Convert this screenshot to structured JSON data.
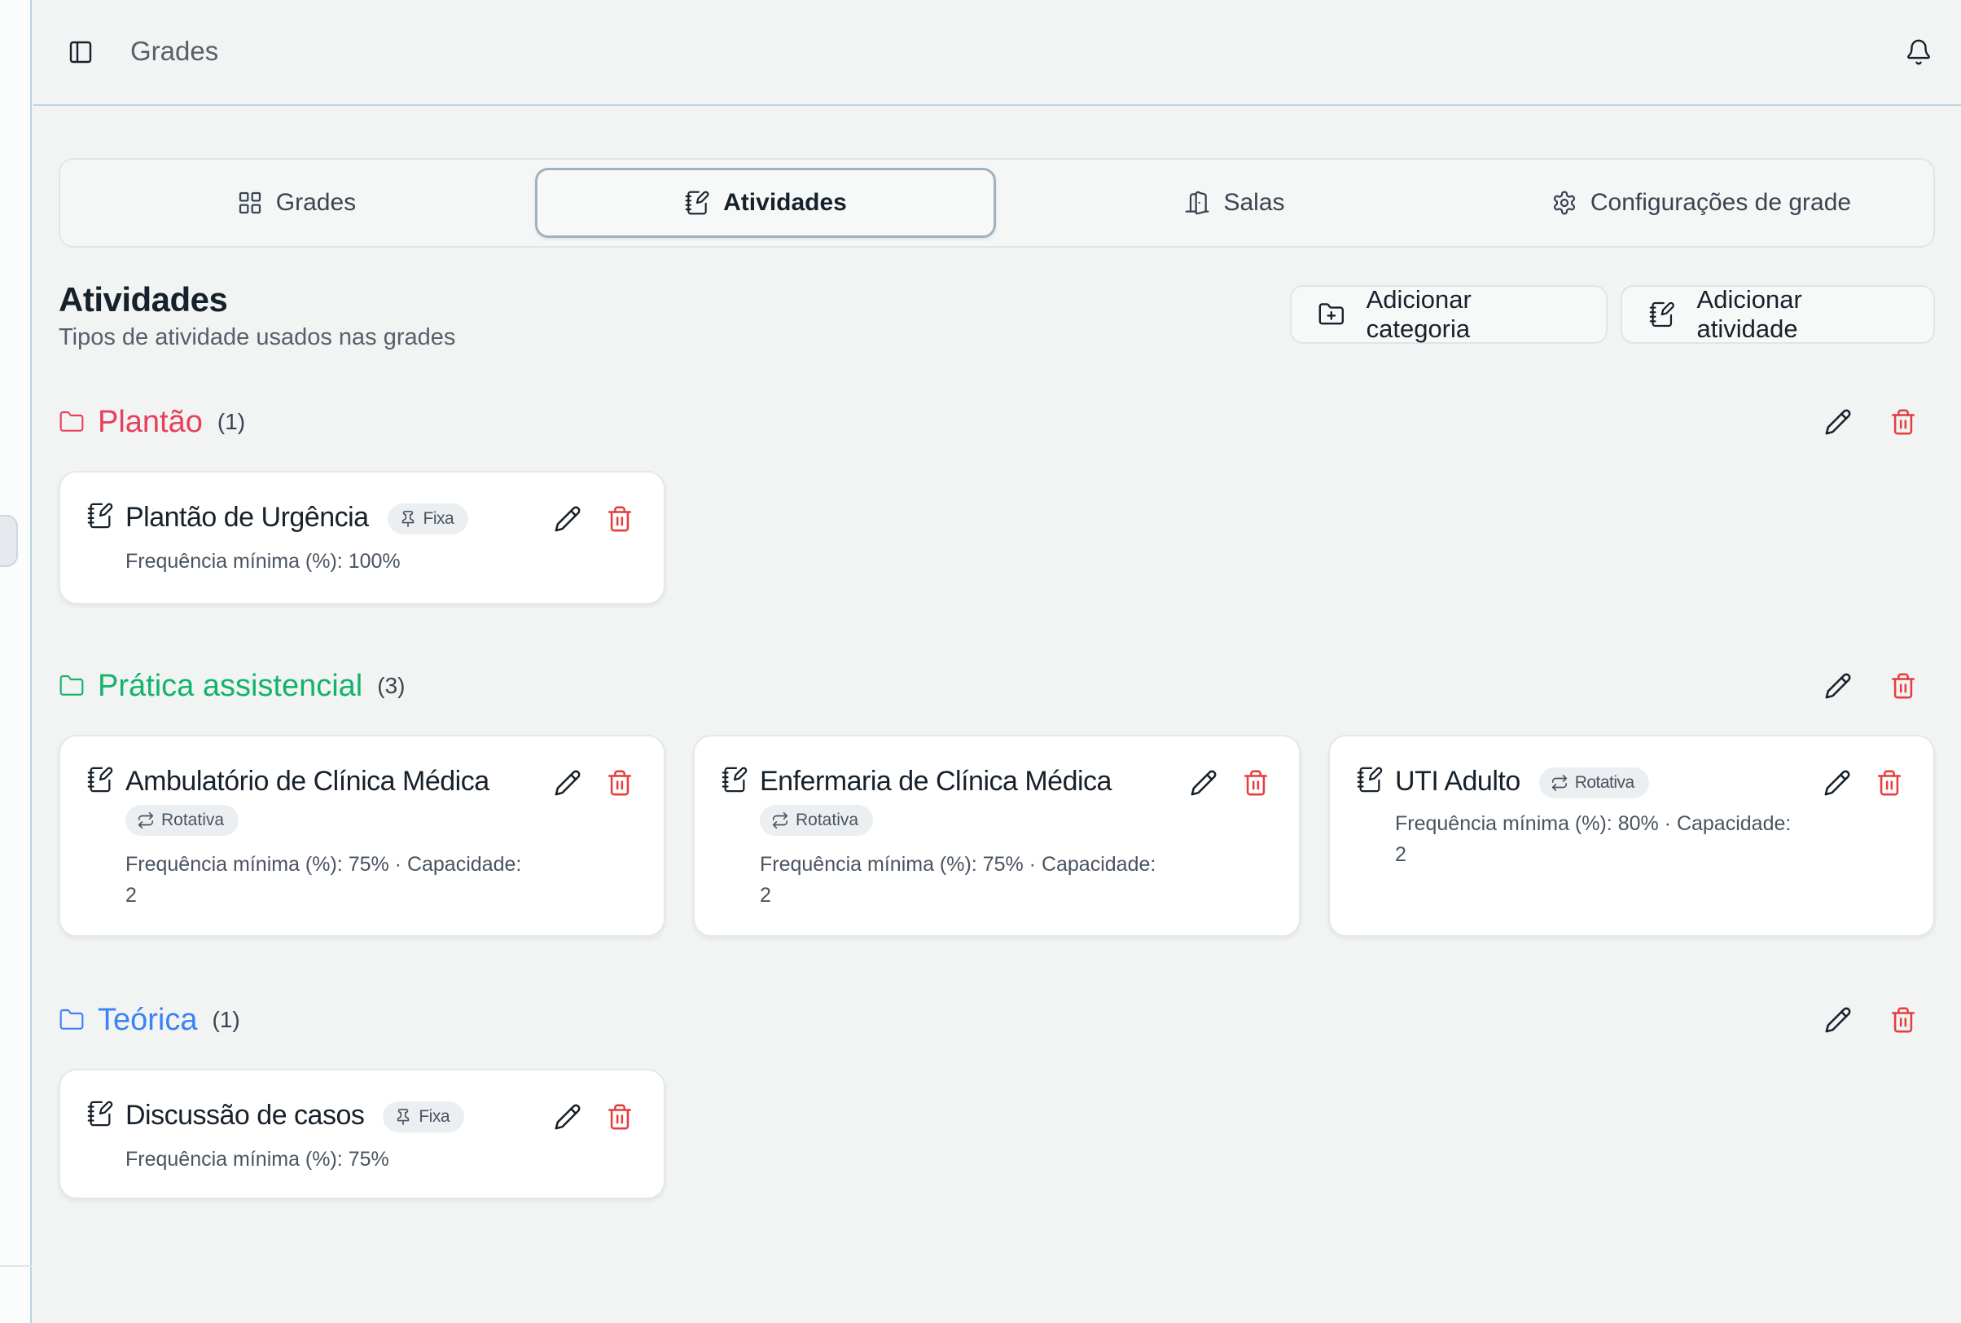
{
  "header": {
    "title": "Grades"
  },
  "tabs": [
    {
      "label": "Grades",
      "icon": "grid-icon"
    },
    {
      "label": "Atividades",
      "icon": "notebook-pen-icon",
      "active": true
    },
    {
      "label": "Salas",
      "icon": "door-icon"
    },
    {
      "label": "Configurações de grade",
      "icon": "gear-icon"
    }
  ],
  "page": {
    "title": "Atividades",
    "subtitle": "Tipos de atividade usados nas grades",
    "add_category": "Adicionar categoria",
    "add_activity": "Adicionar atividade"
  },
  "colors": {
    "plantao": "#e8405c",
    "pratica": "#14b36b",
    "teorica": "#3b82f6",
    "delete": "#e53e3e"
  },
  "categories": [
    {
      "name": "Plantão",
      "count": "(1)",
      "activities": [
        {
          "title": "Plantão de Urgência",
          "badge": "Fixa",
          "desc": "Frequência mínima (%): 100%"
        }
      ]
    },
    {
      "name": "Prática assistencial",
      "count": "(3)",
      "activities": [
        {
          "title": "Ambulatório de Clínica Médica",
          "badge": "Rotativa",
          "desc_line1": "Frequência mínima (%): 75% · Capacidade:",
          "desc_line2": "2"
        },
        {
          "title": "Enfermaria de Clínica Médica",
          "badge": "Rotativa",
          "desc_line1": "Frequência mínima (%): 75% · Capacidade:",
          "desc_line2": "2"
        },
        {
          "title": "UTI Adulto",
          "badge": "Rotativa",
          "desc_line1": "Frequência mínima (%): 80% · Capacidade:",
          "desc_line2": "2"
        }
      ]
    },
    {
      "name": "Teórica",
      "count": "(1)",
      "activities": [
        {
          "title": "Discussão de casos",
          "badge": "Fixa",
          "desc": "Frequência mínima (%): 75%"
        }
      ]
    }
  ]
}
